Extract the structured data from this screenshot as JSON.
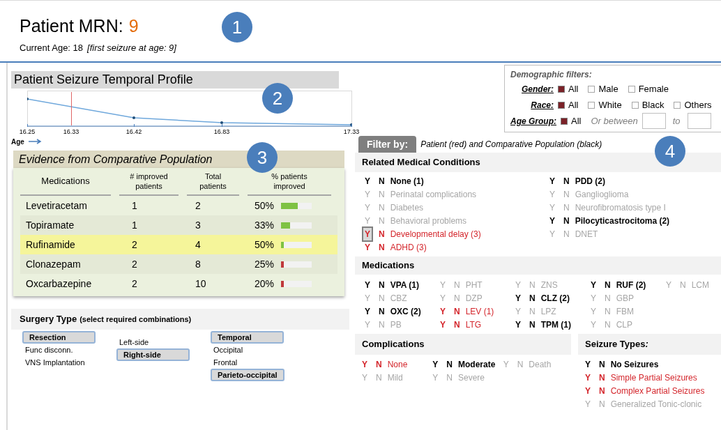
{
  "header": {
    "title": "Patient MRN:",
    "mrn": "9",
    "age": "Current Age: 18",
    "first_seizure": "[first seizure at age: 9]"
  },
  "callouts": [
    "1",
    "2",
    "3",
    "4"
  ],
  "temporal_profile": {
    "title": "Patient Seizure Temporal Profile",
    "ticks": [
      {
        "label": "16.25",
        "marked": false
      },
      {
        "label": "16.33",
        "marked": true
      },
      {
        "label": "16.42",
        "marked": false
      },
      {
        "label": "16.83",
        "marked": false
      },
      {
        "label": "17.33",
        "marked": false
      }
    ],
    "axis_label": "Age"
  },
  "evidence": {
    "title": "Evidence from Comparative Population",
    "columns": [
      "Medications",
      "# improved patients",
      "Total patients",
      "% patients improved"
    ],
    "rows": [
      {
        "medication": "Levetiracetam",
        "improved": "1",
        "total": "2",
        "percent": "50%",
        "level": 0.55,
        "color": "#7ec242",
        "selected": false
      },
      {
        "medication": "Topiramate",
        "improved": "1",
        "total": "3",
        "percent": "33%",
        "level": 0.3,
        "color": "#7ec242",
        "selected": false
      },
      {
        "medication": "Rufinamide",
        "improved": "2",
        "total": "4",
        "percent": "50%",
        "level": 0.1,
        "color": "#7ec242",
        "selected": true
      },
      {
        "medication": "Clonazepam",
        "improved": "2",
        "total": "8",
        "percent": "25%",
        "level": 0.08,
        "color": "#c0393b",
        "selected": false
      },
      {
        "medication": "Oxcarbazepine",
        "improved": "2",
        "total": "10",
        "percent": "20%",
        "level": 0.08,
        "color": "#c0393b",
        "selected": false
      }
    ]
  },
  "surgery": {
    "title": "Surgery Type",
    "hint": "(select required combinations)",
    "columns": [
      [
        {
          "label": "Resection",
          "selected": true
        },
        {
          "label": "Func disconn.",
          "selected": false
        },
        {
          "label": "VNS Implantation",
          "selected": false
        }
      ],
      [
        {
          "label": "Left-side",
          "selected": false
        },
        {
          "label": "Right-side",
          "selected": true
        }
      ],
      [
        {
          "label": "Temporal",
          "selected": true
        },
        {
          "label": "Occipital",
          "selected": false
        },
        {
          "label": "Frontal",
          "selected": false
        },
        {
          "label": "Parieto-occipital",
          "selected": true
        }
      ]
    ]
  },
  "demographics": {
    "title": "Demographic filters:",
    "rows": [
      {
        "label": "Gender:",
        "options": [
          {
            "label": "All",
            "checked": true
          },
          {
            "label": "Male",
            "checked": false
          },
          {
            "label": "Female",
            "checked": false
          }
        ]
      },
      {
        "label": "Race:",
        "options": [
          {
            "label": "All",
            "checked": true
          },
          {
            "label": "White",
            "checked": false
          },
          {
            "label": "Black",
            "checked": false
          },
          {
            "label": "Others",
            "checked": false
          }
        ]
      },
      {
        "label": "Age Group:",
        "options": [
          {
            "label": "All",
            "checked": true
          }
        ],
        "range_text": "Or between",
        "to_text": "to"
      }
    ]
  },
  "filter": {
    "tab": "Filter by:",
    "legend": "Patient (red) and Comparative Population (black)"
  },
  "conditions": {
    "title": "Related Medical Conditions",
    "columns": [
      [
        {
          "y": "Y",
          "n": "N",
          "label": "None (1)",
          "kind": "population",
          "selected": false
        },
        {
          "y": "Y",
          "n": "N",
          "label": "Perinatal complications",
          "kind": "absent",
          "selected": false
        },
        {
          "y": "Y",
          "n": "N",
          "label": "Diabetes",
          "kind": "absent",
          "selected": false
        },
        {
          "y": "Y",
          "n": "N",
          "label": "Behavioral problems",
          "kind": "absent",
          "selected": false
        },
        {
          "y": "Y",
          "n": "N",
          "label": "Developmental delay (3)",
          "kind": "patient",
          "selected": true
        },
        {
          "y": "Y",
          "n": "N",
          "label": "ADHD (3)",
          "kind": "patient",
          "selected": false
        }
      ],
      [
        {
          "y": "Y",
          "n": "N",
          "label": "PDD (2)",
          "kind": "population",
          "selected": false
        },
        {
          "y": "Y",
          "n": "N",
          "label": "Ganglioglioma",
          "kind": "absent",
          "selected": false
        },
        {
          "y": "Y",
          "n": "N",
          "label": "Neurofibromatosis type I",
          "kind": "absent",
          "selected": false
        },
        {
          "y": "Y",
          "n": "N",
          "label": "Pilocyticastrocitoma (2)",
          "kind": "population",
          "selected": false
        },
        {
          "y": "Y",
          "n": "N",
          "label": "DNET",
          "kind": "absent",
          "selected": false
        }
      ]
    ]
  },
  "medications": {
    "title": "Medications",
    "columns": [
      [
        {
          "y": "Y",
          "n": "N",
          "label": "VPA (1)",
          "kind": "population"
        },
        {
          "y": "Y",
          "n": "N",
          "label": "CBZ",
          "kind": "absent"
        },
        {
          "y": "Y",
          "n": "N",
          "label": "OXC (2)",
          "kind": "population"
        },
        {
          "y": "Y",
          "n": "N",
          "label": "PB",
          "kind": "absent"
        }
      ],
      [
        {
          "y": "Y",
          "n": "N",
          "label": "PHT",
          "kind": "absent"
        },
        {
          "y": "Y",
          "n": "N",
          "label": "DZP",
          "kind": "absent"
        },
        {
          "y": "Y",
          "n": "N",
          "label": "LEV (1)",
          "kind": "patient"
        },
        {
          "y": "Y",
          "n": "N",
          "label": "LTG",
          "kind": "patient"
        }
      ],
      [
        {
          "y": "Y",
          "n": "N",
          "label": "ZNS",
          "kind": "absent"
        },
        {
          "y": "Y",
          "n": "N",
          "label": "CLZ (2)",
          "kind": "population"
        },
        {
          "y": "Y",
          "n": "N",
          "label": "LPZ",
          "kind": "absent"
        },
        {
          "y": "Y",
          "n": "N",
          "label": "TPM (1)",
          "kind": "population"
        }
      ],
      [
        {
          "y": "Y",
          "n": "N",
          "label": "RUF (2)",
          "kind": "population"
        },
        {
          "y": "Y",
          "n": "N",
          "label": "GBP",
          "kind": "absent"
        },
        {
          "y": "Y",
          "n": "N",
          "label": "FBM",
          "kind": "absent"
        },
        {
          "y": "Y",
          "n": "N",
          "label": "CLP",
          "kind": "absent"
        }
      ],
      [
        {
          "y": "Y",
          "n": "N",
          "label": "LCM",
          "kind": "absent"
        }
      ]
    ]
  },
  "complications": {
    "title": "Complications",
    "columns": [
      [
        {
          "y": "Y",
          "n": "N",
          "label": "None",
          "kind": "patient"
        },
        {
          "y": "Y",
          "n": "N",
          "label": "Mild",
          "kind": "absent"
        }
      ],
      [
        {
          "y": "Y",
          "n": "N",
          "label": "Moderate",
          "kind": "population"
        },
        {
          "y": "Y",
          "n": "N",
          "label": "Severe",
          "kind": "absent"
        }
      ],
      [
        {
          "y": "Y",
          "n": "N",
          "label": "Death",
          "kind": "absent"
        }
      ]
    ]
  },
  "seizure_types": {
    "title": "Seizure Types",
    "title_suffix": ":",
    "items": [
      {
        "y": "Y",
        "n": "N",
        "label": "No Seizures",
        "kind": "population"
      },
      {
        "y": "Y",
        "n": "N",
        "label": "Simple Partial Seizures",
        "kind": "patient"
      },
      {
        "y": "Y",
        "n": "N",
        "label": "Complex Partial  Seizures",
        "kind": "patient"
      },
      {
        "y": "Y",
        "n": "N",
        "label": "Generalized Tonic-clonic",
        "kind": "absent"
      }
    ]
  }
}
